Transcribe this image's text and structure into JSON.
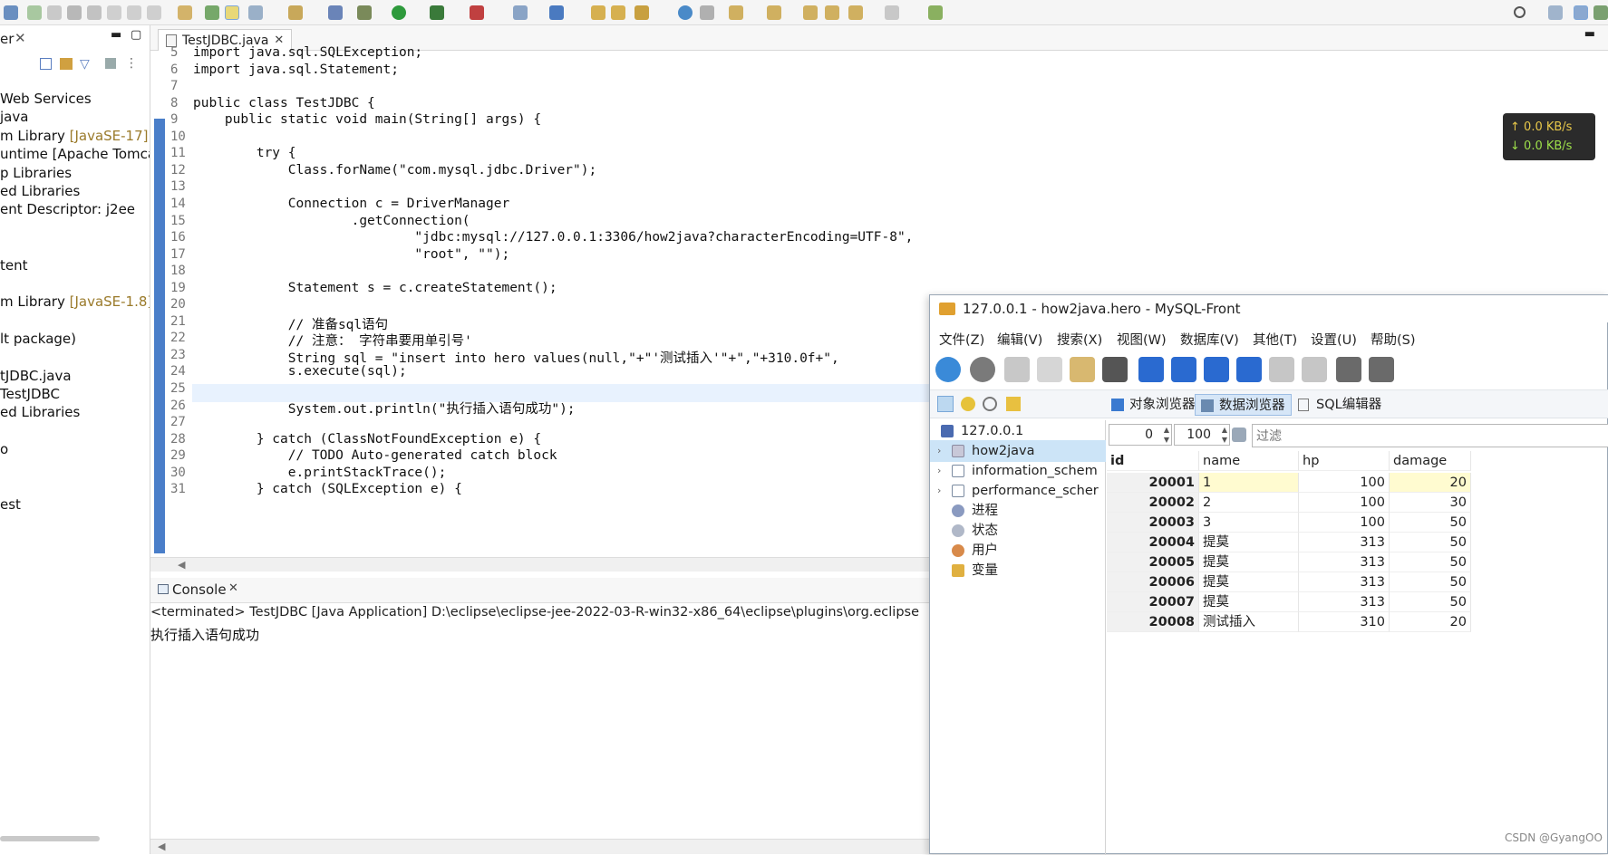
{
  "explorer": {
    "tab_label": "er",
    "items": [
      {
        "text": "Web Services",
        "dim": ""
      },
      {
        "text": "java",
        "dim": ""
      },
      {
        "text": "m Library ",
        "dim": "[JavaSE-17]"
      },
      {
        "text": "untime [Apache Tomca",
        "dim": ""
      },
      {
        "text": "p Libraries",
        "dim": ""
      },
      {
        "text": "ed Libraries",
        "dim": ""
      },
      {
        "text": "ent Descriptor: j2ee",
        "dim": ""
      },
      {
        "text": "tent",
        "dim": ""
      },
      {
        "text": "m Library ",
        "dim": "[JavaSE-1.8]"
      },
      {
        "text": "lt package)",
        "dim": ""
      },
      {
        "text": "tJDBC.java",
        "dim": ""
      },
      {
        "text": "TestJDBC",
        "dim": ""
      },
      {
        "text": "ed Libraries",
        "dim": ""
      },
      {
        "text": "o",
        "dim": ""
      },
      {
        "text": "est",
        "dim": ""
      }
    ]
  },
  "editor": {
    "tab_label": "TestJDBC.java",
    "lines": [
      {
        "n": "5",
        "code": "import java.sql.SQLException;"
      },
      {
        "n": "6",
        "code": "import java.sql.Statement;"
      },
      {
        "n": "7",
        "code": ""
      },
      {
        "n": "8",
        "code": "public class TestJDBC {"
      },
      {
        "n": "9",
        "code": "    public static void main(String[] args) {"
      },
      {
        "n": "10",
        "code": ""
      },
      {
        "n": "11",
        "code": "        try {"
      },
      {
        "n": "12",
        "code": "            Class.forName(\"com.mysql.jdbc.Driver\");"
      },
      {
        "n": "13",
        "code": ""
      },
      {
        "n": "14",
        "code": "            Connection c = DriverManager"
      },
      {
        "n": "15",
        "code": "                    .getConnection("
      },
      {
        "n": "16",
        "code": "                            \"jdbc:mysql://127.0.0.1:3306/how2java?characterEncoding=UTF-8\","
      },
      {
        "n": "17",
        "code": "                            \"root\", \"\");"
      },
      {
        "n": "18",
        "code": ""
      },
      {
        "n": "19",
        "code": "            Statement s = c.createStatement();"
      },
      {
        "n": "20",
        "code": ""
      },
      {
        "n": "21",
        "code": "            // 准备sql语句"
      },
      {
        "n": "22",
        "code": "            // 注意： 字符串要用单引号'"
      },
      {
        "n": "23",
        "code": "            String sql = \"insert into hero values(null,\"+\"'测试插入'\"+\",\"+310.0f+\","
      },
      {
        "n": "24",
        "code": "            s.execute(sql);"
      },
      {
        "n": "25",
        "code": ""
      },
      {
        "n": "26",
        "code": "            System.out.println(\"执行插入语句成功\");"
      },
      {
        "n": "27",
        "code": ""
      },
      {
        "n": "28",
        "code": "        } catch (ClassNotFoundException e) {"
      },
      {
        "n": "29",
        "code": "            // TODO Auto-generated catch block"
      },
      {
        "n": "30",
        "code": "            e.printStackTrace();"
      },
      {
        "n": "31",
        "code": "        } catch (SQLException e) {"
      }
    ]
  },
  "console": {
    "tab_label": "Console",
    "terminated": "<terminated> TestJDBC [Java Application] D:\\eclipse\\eclipse-jee-2022-03-R-win32-x86_64\\eclipse\\plugins\\org.eclipse",
    "output": "执行插入语句成功"
  },
  "network": {
    "up": "0.0 KB/s",
    "down": "0.0 KB/s"
  },
  "mysqlfront": {
    "title": "127.0.0.1 - how2java.hero - MySQL-Front",
    "menu": [
      "文件(Z)",
      "编辑(V)",
      "搜索(X)",
      "视图(W)",
      "数据库(V)",
      "其他(T)",
      "设置(U)",
      "帮助(S)"
    ],
    "tabs": [
      "对象浏览器",
      "数据浏览器",
      "SQL编辑器"
    ],
    "tree": [
      {
        "label": "127.0.0.1",
        "arrow": ""
      },
      {
        "label": "how2java",
        "arrow": "›"
      },
      {
        "label": "information_schem",
        "arrow": "›"
      },
      {
        "label": "performance_scher",
        "arrow": "›"
      },
      {
        "label": "进程",
        "arrow": ""
      },
      {
        "label": "状态",
        "arrow": ""
      },
      {
        "label": "用户",
        "arrow": ""
      },
      {
        "label": "变量",
        "arrow": ""
      }
    ],
    "offset": "0",
    "limit": "100",
    "filter_placeholder": "过滤",
    "columns": [
      "id",
      "name",
      "hp",
      "damage"
    ],
    "rows": [
      [
        "20001",
        "1",
        "100",
        "20"
      ],
      [
        "20002",
        "2",
        "100",
        "30"
      ],
      [
        "20003",
        "3",
        "100",
        "50"
      ],
      [
        "20004",
        "提莫",
        "313",
        "50"
      ],
      [
        "20005",
        "提莫",
        "313",
        "50"
      ],
      [
        "20006",
        "提莫",
        "313",
        "50"
      ],
      [
        "20007",
        "提莫",
        "313",
        "50"
      ],
      [
        "20008",
        "测试插入",
        "310",
        "20"
      ]
    ]
  },
  "watermark": "CSDN @GyangOO"
}
